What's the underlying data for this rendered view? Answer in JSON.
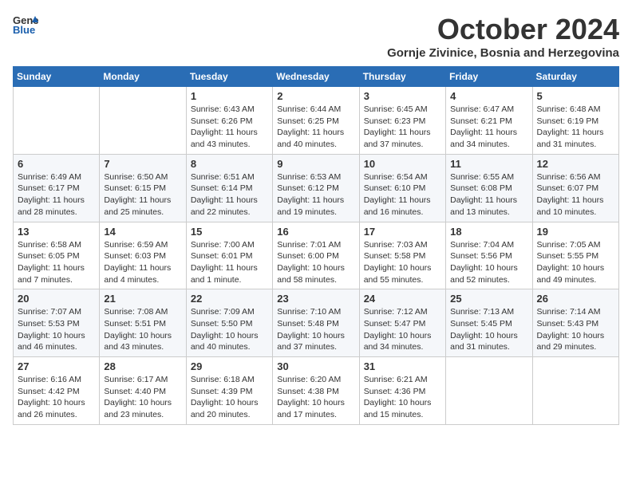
{
  "header": {
    "logo_line1": "General",
    "logo_line2": "Blue",
    "month_title": "October 2024",
    "subtitle": "Gornje Zivinice, Bosnia and Herzegovina"
  },
  "days_of_week": [
    "Sunday",
    "Monday",
    "Tuesday",
    "Wednesday",
    "Thursday",
    "Friday",
    "Saturday"
  ],
  "weeks": [
    [
      {
        "day": "",
        "sunrise": "",
        "sunset": "",
        "daylight": ""
      },
      {
        "day": "",
        "sunrise": "",
        "sunset": "",
        "daylight": ""
      },
      {
        "day": "1",
        "sunrise": "Sunrise: 6:43 AM",
        "sunset": "Sunset: 6:26 PM",
        "daylight": "Daylight: 11 hours and 43 minutes."
      },
      {
        "day": "2",
        "sunrise": "Sunrise: 6:44 AM",
        "sunset": "Sunset: 6:25 PM",
        "daylight": "Daylight: 11 hours and 40 minutes."
      },
      {
        "day": "3",
        "sunrise": "Sunrise: 6:45 AM",
        "sunset": "Sunset: 6:23 PM",
        "daylight": "Daylight: 11 hours and 37 minutes."
      },
      {
        "day": "4",
        "sunrise": "Sunrise: 6:47 AM",
        "sunset": "Sunset: 6:21 PM",
        "daylight": "Daylight: 11 hours and 34 minutes."
      },
      {
        "day": "5",
        "sunrise": "Sunrise: 6:48 AM",
        "sunset": "Sunset: 6:19 PM",
        "daylight": "Daylight: 11 hours and 31 minutes."
      }
    ],
    [
      {
        "day": "6",
        "sunrise": "Sunrise: 6:49 AM",
        "sunset": "Sunset: 6:17 PM",
        "daylight": "Daylight: 11 hours and 28 minutes."
      },
      {
        "day": "7",
        "sunrise": "Sunrise: 6:50 AM",
        "sunset": "Sunset: 6:15 PM",
        "daylight": "Daylight: 11 hours and 25 minutes."
      },
      {
        "day": "8",
        "sunrise": "Sunrise: 6:51 AM",
        "sunset": "Sunset: 6:14 PM",
        "daylight": "Daylight: 11 hours and 22 minutes."
      },
      {
        "day": "9",
        "sunrise": "Sunrise: 6:53 AM",
        "sunset": "Sunset: 6:12 PM",
        "daylight": "Daylight: 11 hours and 19 minutes."
      },
      {
        "day": "10",
        "sunrise": "Sunrise: 6:54 AM",
        "sunset": "Sunset: 6:10 PM",
        "daylight": "Daylight: 11 hours and 16 minutes."
      },
      {
        "day": "11",
        "sunrise": "Sunrise: 6:55 AM",
        "sunset": "Sunset: 6:08 PM",
        "daylight": "Daylight: 11 hours and 13 minutes."
      },
      {
        "day": "12",
        "sunrise": "Sunrise: 6:56 AM",
        "sunset": "Sunset: 6:07 PM",
        "daylight": "Daylight: 11 hours and 10 minutes."
      }
    ],
    [
      {
        "day": "13",
        "sunrise": "Sunrise: 6:58 AM",
        "sunset": "Sunset: 6:05 PM",
        "daylight": "Daylight: 11 hours and 7 minutes."
      },
      {
        "day": "14",
        "sunrise": "Sunrise: 6:59 AM",
        "sunset": "Sunset: 6:03 PM",
        "daylight": "Daylight: 11 hours and 4 minutes."
      },
      {
        "day": "15",
        "sunrise": "Sunrise: 7:00 AM",
        "sunset": "Sunset: 6:01 PM",
        "daylight": "Daylight: 11 hours and 1 minute."
      },
      {
        "day": "16",
        "sunrise": "Sunrise: 7:01 AM",
        "sunset": "Sunset: 6:00 PM",
        "daylight": "Daylight: 10 hours and 58 minutes."
      },
      {
        "day": "17",
        "sunrise": "Sunrise: 7:03 AM",
        "sunset": "Sunset: 5:58 PM",
        "daylight": "Daylight: 10 hours and 55 minutes."
      },
      {
        "day": "18",
        "sunrise": "Sunrise: 7:04 AM",
        "sunset": "Sunset: 5:56 PM",
        "daylight": "Daylight: 10 hours and 52 minutes."
      },
      {
        "day": "19",
        "sunrise": "Sunrise: 7:05 AM",
        "sunset": "Sunset: 5:55 PM",
        "daylight": "Daylight: 10 hours and 49 minutes."
      }
    ],
    [
      {
        "day": "20",
        "sunrise": "Sunrise: 7:07 AM",
        "sunset": "Sunset: 5:53 PM",
        "daylight": "Daylight: 10 hours and 46 minutes."
      },
      {
        "day": "21",
        "sunrise": "Sunrise: 7:08 AM",
        "sunset": "Sunset: 5:51 PM",
        "daylight": "Daylight: 10 hours and 43 minutes."
      },
      {
        "day": "22",
        "sunrise": "Sunrise: 7:09 AM",
        "sunset": "Sunset: 5:50 PM",
        "daylight": "Daylight: 10 hours and 40 minutes."
      },
      {
        "day": "23",
        "sunrise": "Sunrise: 7:10 AM",
        "sunset": "Sunset: 5:48 PM",
        "daylight": "Daylight: 10 hours and 37 minutes."
      },
      {
        "day": "24",
        "sunrise": "Sunrise: 7:12 AM",
        "sunset": "Sunset: 5:47 PM",
        "daylight": "Daylight: 10 hours and 34 minutes."
      },
      {
        "day": "25",
        "sunrise": "Sunrise: 7:13 AM",
        "sunset": "Sunset: 5:45 PM",
        "daylight": "Daylight: 10 hours and 31 minutes."
      },
      {
        "day": "26",
        "sunrise": "Sunrise: 7:14 AM",
        "sunset": "Sunset: 5:43 PM",
        "daylight": "Daylight: 10 hours and 29 minutes."
      }
    ],
    [
      {
        "day": "27",
        "sunrise": "Sunrise: 6:16 AM",
        "sunset": "Sunset: 4:42 PM",
        "daylight": "Daylight: 10 hours and 26 minutes."
      },
      {
        "day": "28",
        "sunrise": "Sunrise: 6:17 AM",
        "sunset": "Sunset: 4:40 PM",
        "daylight": "Daylight: 10 hours and 23 minutes."
      },
      {
        "day": "29",
        "sunrise": "Sunrise: 6:18 AM",
        "sunset": "Sunset: 4:39 PM",
        "daylight": "Daylight: 10 hours and 20 minutes."
      },
      {
        "day": "30",
        "sunrise": "Sunrise: 6:20 AM",
        "sunset": "Sunset: 4:38 PM",
        "daylight": "Daylight: 10 hours and 17 minutes."
      },
      {
        "day": "31",
        "sunrise": "Sunrise: 6:21 AM",
        "sunset": "Sunset: 4:36 PM",
        "daylight": "Daylight: 10 hours and 15 minutes."
      },
      {
        "day": "",
        "sunrise": "",
        "sunset": "",
        "daylight": ""
      },
      {
        "day": "",
        "sunrise": "",
        "sunset": "",
        "daylight": ""
      }
    ]
  ]
}
